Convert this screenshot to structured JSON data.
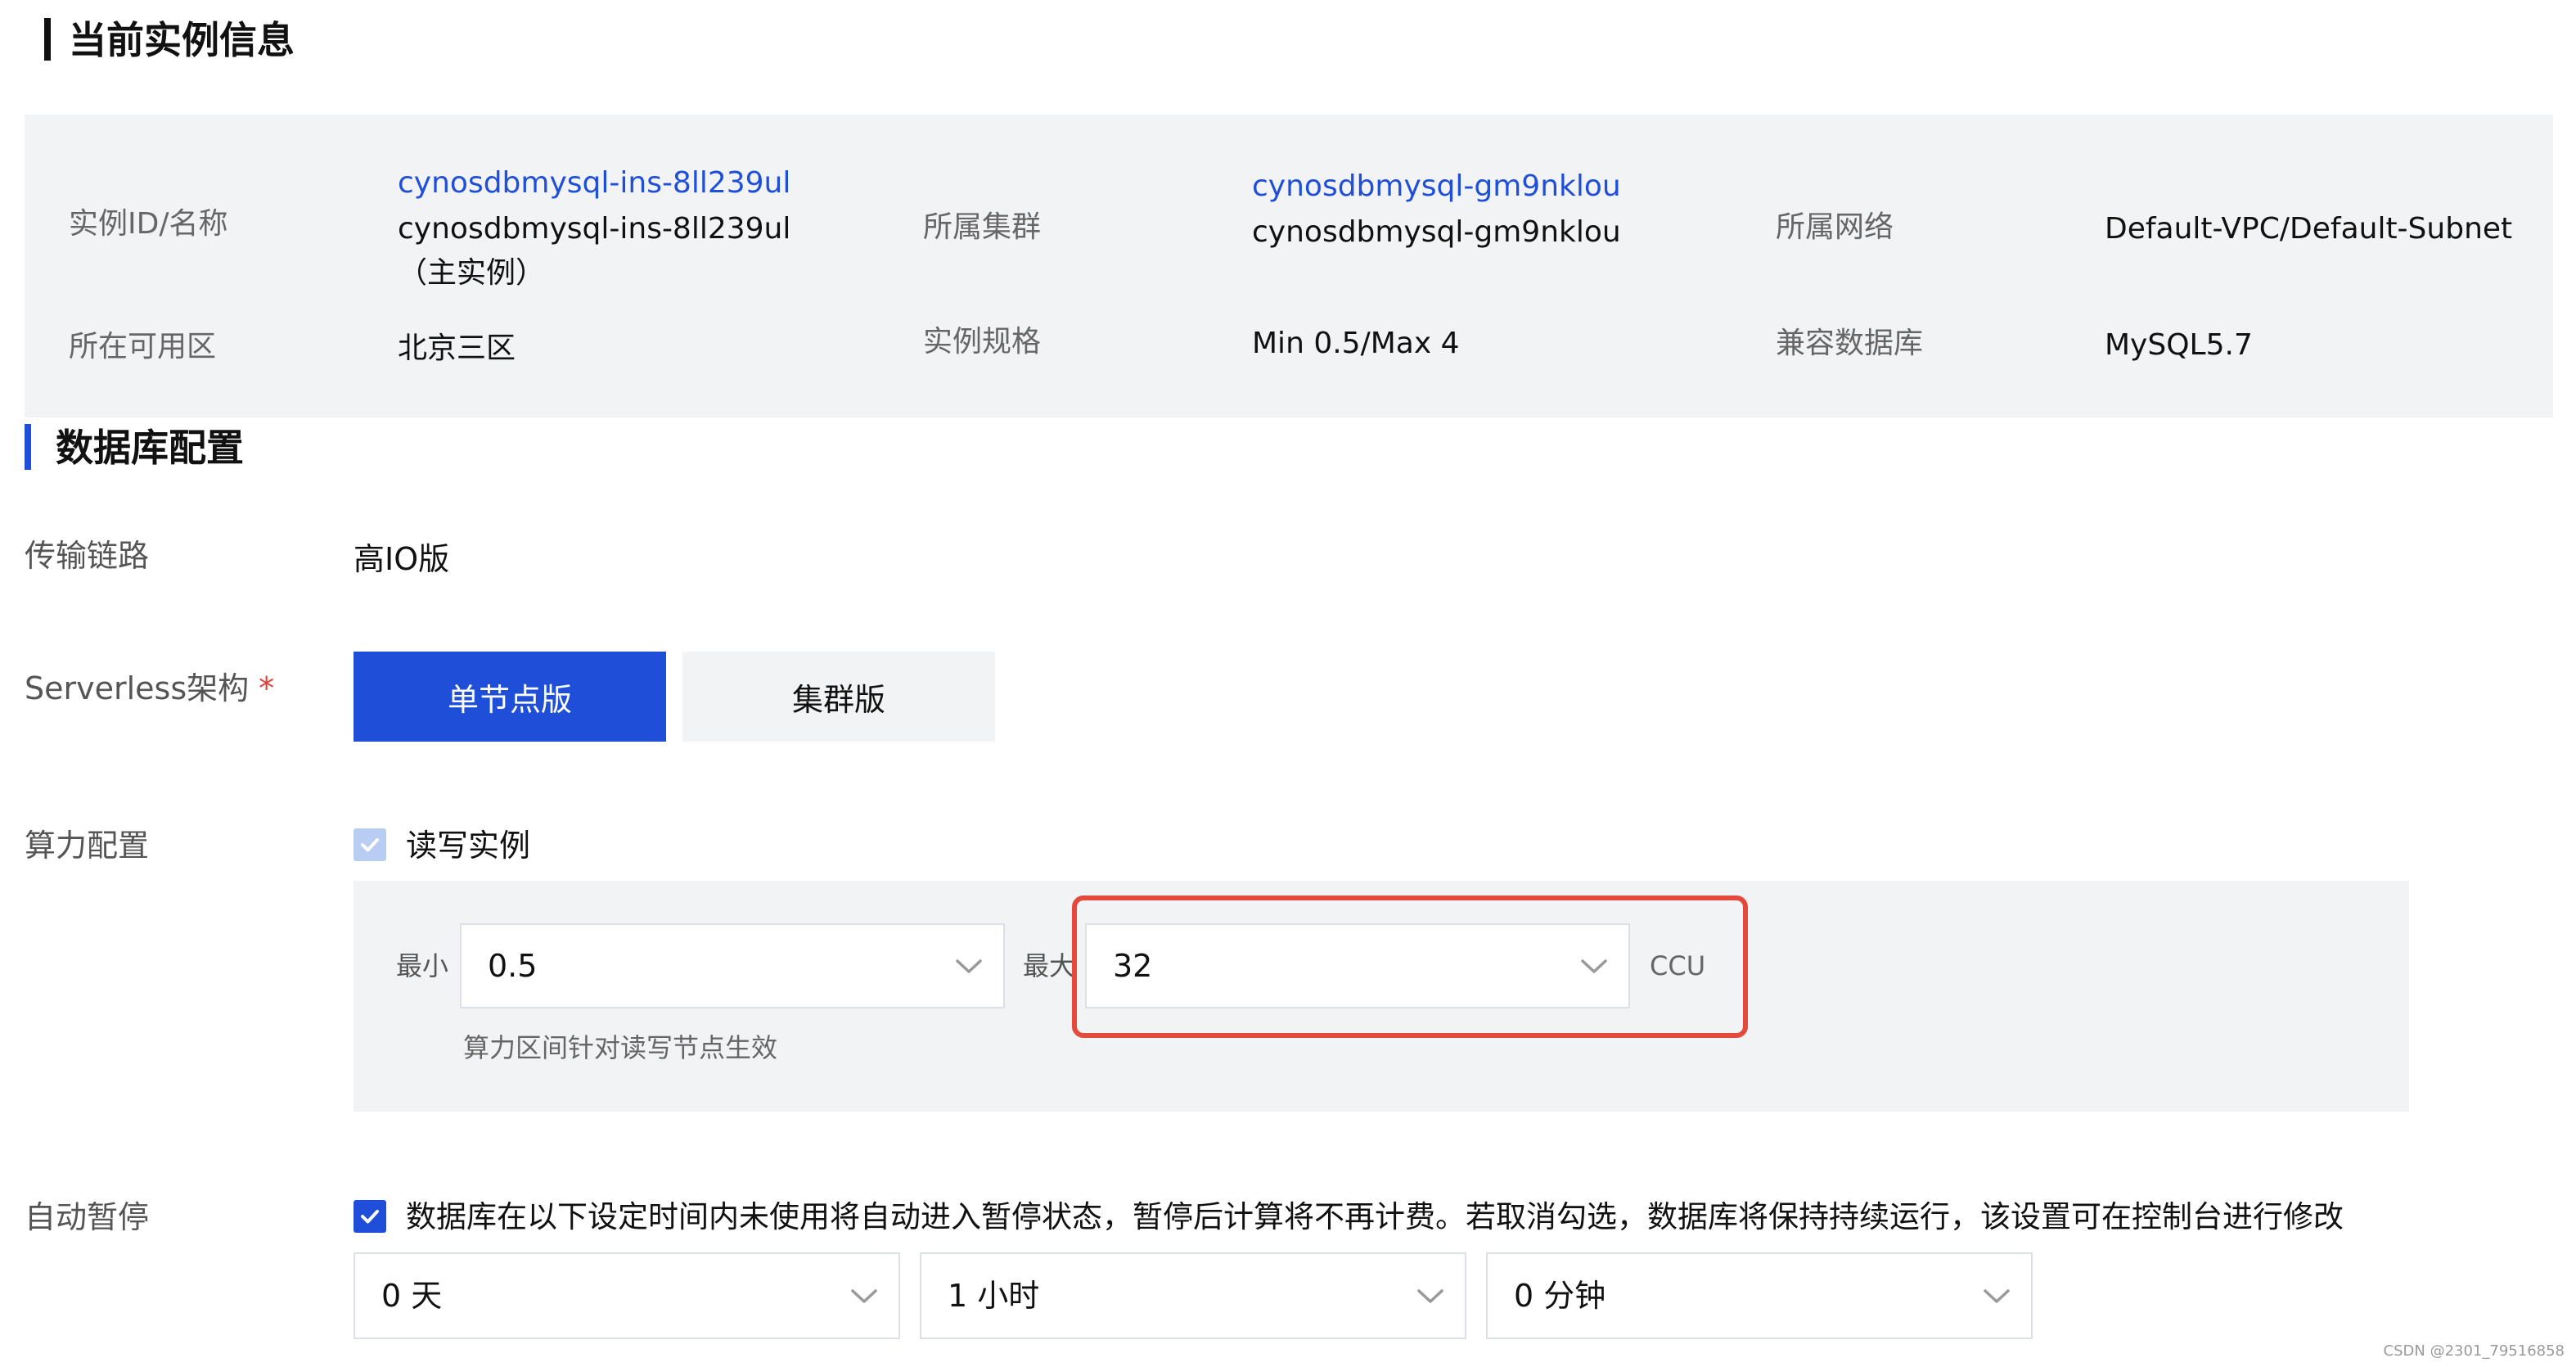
{
  "current_instance": {
    "title": "当前实例信息",
    "rows": [
      {
        "instance_id_label": "实例ID/名称",
        "instance_id_link": "cynosdbmysql-ins-8ll239ul",
        "instance_name": "cynosdbmysql-ins-8ll239ul",
        "instance_role": "（主实例）",
        "cluster_label": "所属集群",
        "cluster_link": "cynosdbmysql-gm9nklou",
        "cluster_name": "cynosdbmysql-gm9nklou",
        "network_label": "所属网络",
        "network_value": "Default-VPC/Default-Subnet"
      },
      {
        "zone_label": "所在可用区",
        "zone_value": "北京三区",
        "spec_label": "实例规格",
        "spec_value": "Min 0.5/Max 4",
        "compat_label": "兼容数据库",
        "compat_value": "MySQL5.7"
      }
    ]
  },
  "db_config": {
    "title": "数据库配置",
    "link_label": "传输链路",
    "link_value": "高IO版",
    "arch_label": "Serverless架构",
    "arch_required": "*",
    "arch_options": [
      "单节点版",
      "集群版"
    ],
    "compute_label": "算力配置",
    "compute_checkbox_label": "读写实例",
    "min_label": "最小",
    "min_value": "0.5",
    "max_label": "最大",
    "max_value": "32",
    "unit": "CCU",
    "compute_hint": "算力区间针对读写节点生效",
    "auto_pause_label": "自动暂停",
    "auto_pause_text": "数据库在以下设定时间内未使用将自动进入暂停状态，暂停后计算将不再计费。若取消勾选，数据库将保持持续运行，该设置可在控制台进行修改",
    "pause_days": "0 天",
    "pause_hours": "1 小时",
    "pause_minutes": "0 分钟"
  },
  "watermark": "CSDN @2301_79516858",
  "colors": {
    "accent": "#1f4fd8",
    "panel_bg": "#f2f3f5",
    "highlight": "#e34a3b",
    "required": "#e0403a"
  }
}
